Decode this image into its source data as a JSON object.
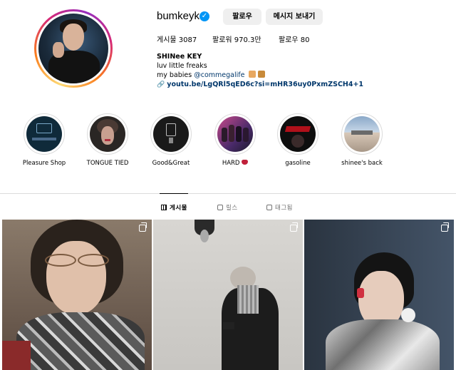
{
  "profile": {
    "username": "bumkeyk",
    "follow_label": "팔로우",
    "message_label": "메시지 보내기",
    "stats": {
      "posts": "게시물 3087",
      "followers": "팔로워 970.3만",
      "following": "팔로우 80"
    },
    "bio": {
      "name": "SHINee KEY",
      "line1": "luv little freaks",
      "line2_prefix": "my babies ",
      "mention": "@commegalife",
      "link": "youtu.be/LgQRl5qED6c?si=mHR36uy0PxmZSCH4+1"
    }
  },
  "highlights": [
    {
      "label": "Pleasure Shop"
    },
    {
      "label": "TONGUE TIED"
    },
    {
      "label": "Good&Great"
    },
    {
      "label": "HARD"
    },
    {
      "label": "gasoline"
    },
    {
      "label": "shinee's back"
    }
  ],
  "tabs": {
    "posts": "게시물",
    "reels": "릴스",
    "tagged": "태그됨"
  },
  "colors": {
    "verified": "#0095f6",
    "link": "#00376b",
    "button_bg": "#efefef"
  }
}
